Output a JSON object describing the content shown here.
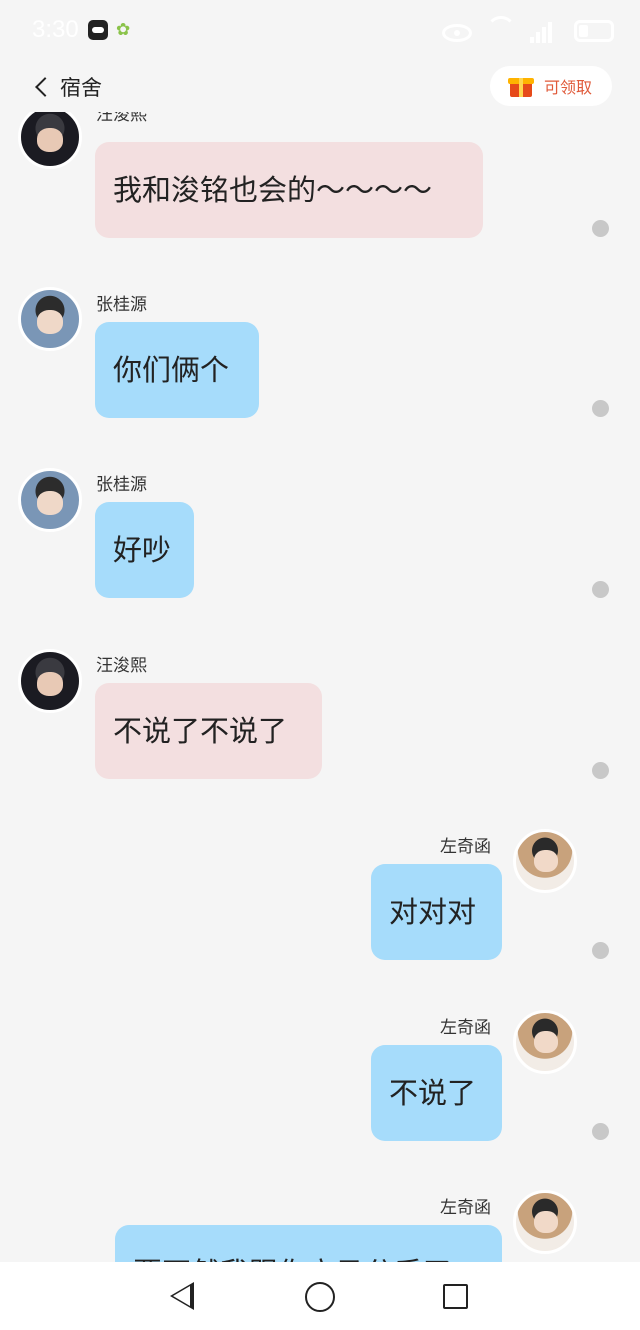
{
  "status_bar": {
    "time": "3:30",
    "icons": [
      "mail-app-icon",
      "wechat-app-icon",
      "eye-icon",
      "wifi-icon",
      "signal-icon",
      "battery-icon"
    ]
  },
  "header": {
    "back_icon": "chevron-left-icon",
    "title": "宿舍",
    "claim_label": "可领取",
    "claim_icon": "gift-icon"
  },
  "messages": [
    {
      "sender": "汪浚熙",
      "text": "我和浚铭也会的～～～～",
      "side": "left",
      "color": "pink"
    },
    {
      "sender": "张桂源",
      "text": "你们俩个",
      "side": "left",
      "color": "blue"
    },
    {
      "sender": "张桂源",
      "text": "好吵",
      "side": "left",
      "color": "blue"
    },
    {
      "sender": "汪浚熙",
      "text": "不说了不说了",
      "side": "left",
      "color": "pink"
    },
    {
      "sender": "左奇函",
      "text": "对对对",
      "side": "right",
      "color": "blue"
    },
    {
      "sender": "左奇函",
      "text": "不说了",
      "side": "right",
      "color": "blue"
    },
    {
      "sender": "左奇函",
      "text": "要不然我跟你立马分手了",
      "side": "right",
      "color": "blue"
    }
  ],
  "nav_bar": {
    "icons": [
      "triangle-back-icon",
      "circle-home-icon",
      "square-recents-icon"
    ]
  },
  "colors": {
    "background": "#f5f5f5",
    "bubble_pink": "#f3dfe0",
    "bubble_blue": "#a6dcfb",
    "claim_text": "#e05a3a"
  }
}
